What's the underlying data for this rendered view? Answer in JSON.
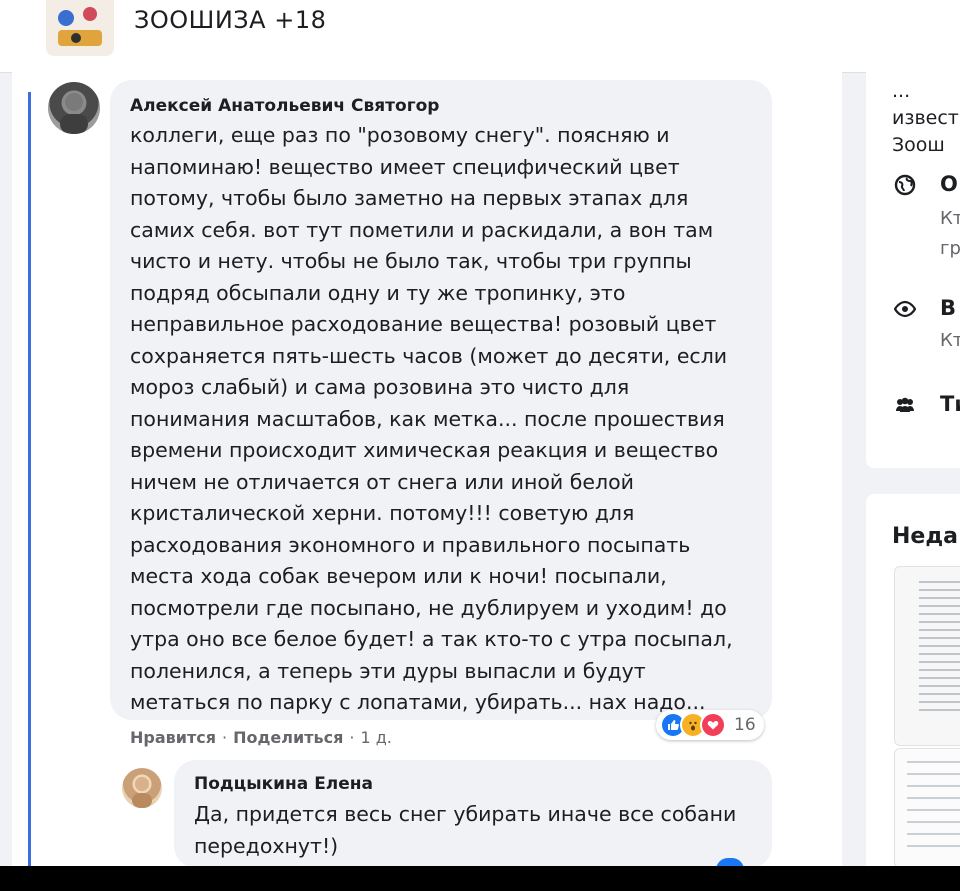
{
  "header": {
    "group_name": "ЗООШИЗА +18"
  },
  "comment": {
    "author": "Алексей Анатольевич Святогор",
    "text": "коллеги, еще раз по \"розовому снегу\". поясняю и\nнапоминаю! вещество имеет специфический цвет\nпотому, чтобы было заметно на первых этапах для\nсамих себя. вот тут пометили и раскидали, а вон там\nчисто и нету. чтобы не было так, чтобы три группы\nподряд обсыпали одну и ту же тропинку, это\nнеправильное расходование вещества! розовый цвет\nсохраняется пять-шесть часов (может до десяти, если\nмороз слабый) и сама розовина это чисто для\nпонимания масштабов, как метка... после прошествия\nвремени происходит химическая реакция и вещество\nничем не отличается от снега или иной белой\nкристалической херни. потому!!! советую для\nрасходования экономного и правильного посыпать\nместа хода собак вечером или к ночи! посыпали,\nпосмотрели где посыпано, не дублируем и уходим! до\nутра оно все белое будет! а так кто-то с утра посыпал,\nполенился, а теперь эти дуры выпасли и будут\nметаться по парку с лопатами, убирать... нах надо...",
    "reaction_count": "16",
    "reactions": [
      "like-icon",
      "wow-icon",
      "love-icon"
    ],
    "actions": {
      "like": "Нравится",
      "separator": "·",
      "share": "Поделиться",
      "time": "1 д."
    }
  },
  "reply": {
    "author": "Подцыкина Елена",
    "text": "Да, придется весь снег убирать иначе все собани\nпередохнут!)"
  },
  "right_panel": {
    "about_fragment": "...\nизвест\nЗоош",
    "rows": [
      {
        "icon": "globe-icon",
        "title": "О",
        "subtitle": "Кт\nгр"
      },
      {
        "icon": "eye-icon",
        "title": "В",
        "subtitle": "Кт"
      },
      {
        "icon": "people-icon",
        "title": "Ти",
        "subtitle": ""
      }
    ],
    "recent_title": "Неда"
  },
  "colors": {
    "thread_line": "#3b6fe0",
    "bubble_bg": "#f0f2f5",
    "like_blue": "#1877f2"
  }
}
